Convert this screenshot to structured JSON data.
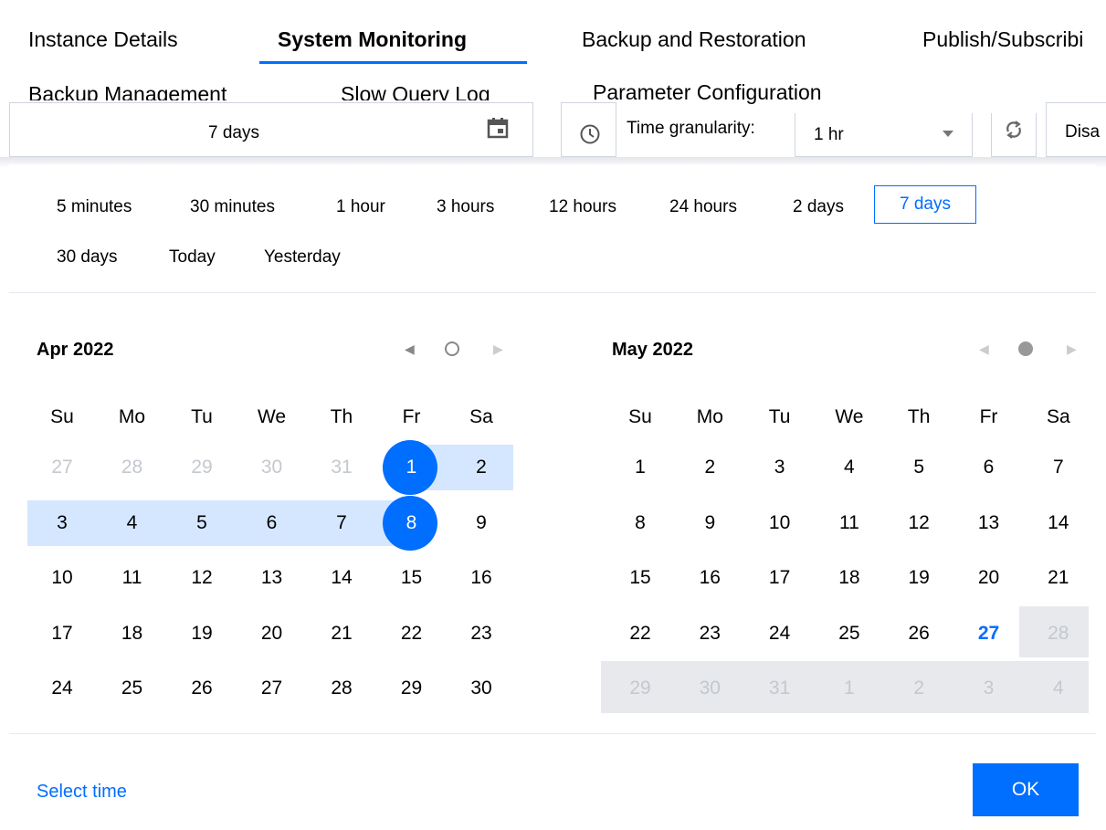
{
  "tabs": [
    {
      "label": "Instance Details"
    },
    {
      "label": "System Monitoring"
    },
    {
      "label": "Backup and Restoration"
    },
    {
      "label": "Publish/Subscribi"
    },
    {
      "label": "Backup Management"
    },
    {
      "label": "Slow Query Log"
    },
    {
      "label": "Parameter Configuration"
    }
  ],
  "toolbar": {
    "date_value": "7 days",
    "granularity_label": "Time granularity:",
    "granularity_value": "1 hr",
    "right_text": "Disa"
  },
  "quick_options": [
    "5 minutes",
    "30 minutes",
    "1 hour",
    "3 hours",
    "12 hours",
    "24 hours",
    "2 days",
    "7 days",
    "30 days",
    "Today",
    "Yesterday"
  ],
  "calendars": [
    {
      "title": "Apr 2022",
      "weekdays": [
        "Su",
        "Mo",
        "Tu",
        "We",
        "Th",
        "Fr",
        "Sa"
      ],
      "weeks": [
        [
          "27",
          "28",
          "29",
          "30",
          "31",
          "1",
          "2"
        ],
        [
          "3",
          "4",
          "5",
          "6",
          "7",
          "8",
          "9"
        ],
        [
          "10",
          "11",
          "12",
          "13",
          "14",
          "15",
          "16"
        ],
        [
          "17",
          "18",
          "19",
          "20",
          "21",
          "22",
          "23"
        ],
        [
          "24",
          "25",
          "26",
          "27",
          "28",
          "29",
          "30"
        ]
      ]
    },
    {
      "title": "May 2022",
      "weekdays": [
        "Su",
        "Mo",
        "Tu",
        "We",
        "Th",
        "Fr",
        "Sa"
      ],
      "weeks": [
        [
          "1",
          "2",
          "3",
          "4",
          "5",
          "6",
          "7"
        ],
        [
          "8",
          "9",
          "10",
          "11",
          "12",
          "13",
          "14"
        ],
        [
          "15",
          "16",
          "17",
          "18",
          "19",
          "20",
          "21"
        ],
        [
          "22",
          "23",
          "24",
          "25",
          "26",
          "27",
          "28"
        ],
        [
          "29",
          "30",
          "31",
          "1",
          "2",
          "3",
          "4"
        ]
      ]
    }
  ],
  "footer": {
    "select_time": "Select time",
    "ok": "OK"
  },
  "colors": {
    "accent": "#006eff",
    "range": "#d5e7ff",
    "disabled": "#e7e9ec"
  }
}
